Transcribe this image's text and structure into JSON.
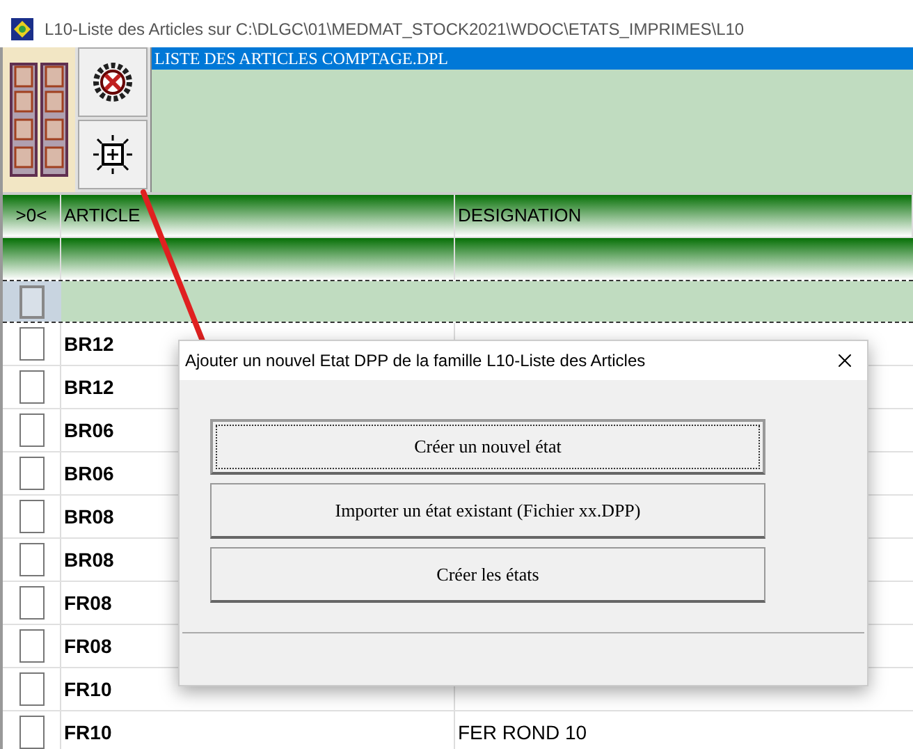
{
  "window": {
    "title": "L10-Liste des Articles sur C:\\DLGC\\01\\MEDMAT_STOCK2021\\WDOC\\ETATS_IMPRIMES\\L10"
  },
  "file_list": [
    {
      "name": "LISTE DES ARTICLES COMPTAGE.DPL",
      "selected": true
    }
  ],
  "table": {
    "columns": [
      ">0<",
      "ARTICLE",
      "DESIGNATION"
    ],
    "rows": [
      {
        "checked": false,
        "article": "BR12"
      },
      {
        "checked": false,
        "article": "BR12"
      },
      {
        "checked": false,
        "article": "BR06"
      },
      {
        "checked": false,
        "article": "BR06"
      },
      {
        "checked": false,
        "article": "BR08"
      },
      {
        "checked": false,
        "article": "BR08"
      },
      {
        "checked": false,
        "article": "FR08"
      },
      {
        "checked": false,
        "article": "FR08"
      },
      {
        "checked": false,
        "article": "FR10"
      },
      {
        "checked": false,
        "article": "FR10",
        "designation": "FER ROND 10"
      }
    ]
  },
  "dialog": {
    "title": "Ajouter un nouvel Etat DPP de la famille L10-Liste des Articles",
    "buttons": [
      {
        "label": "Créer un nouvel état",
        "focused": true
      },
      {
        "label": "Importer un état existant (Fichier xx.DPP)",
        "focused": false
      },
      {
        "label": "Créer les états",
        "focused": false
      }
    ]
  }
}
